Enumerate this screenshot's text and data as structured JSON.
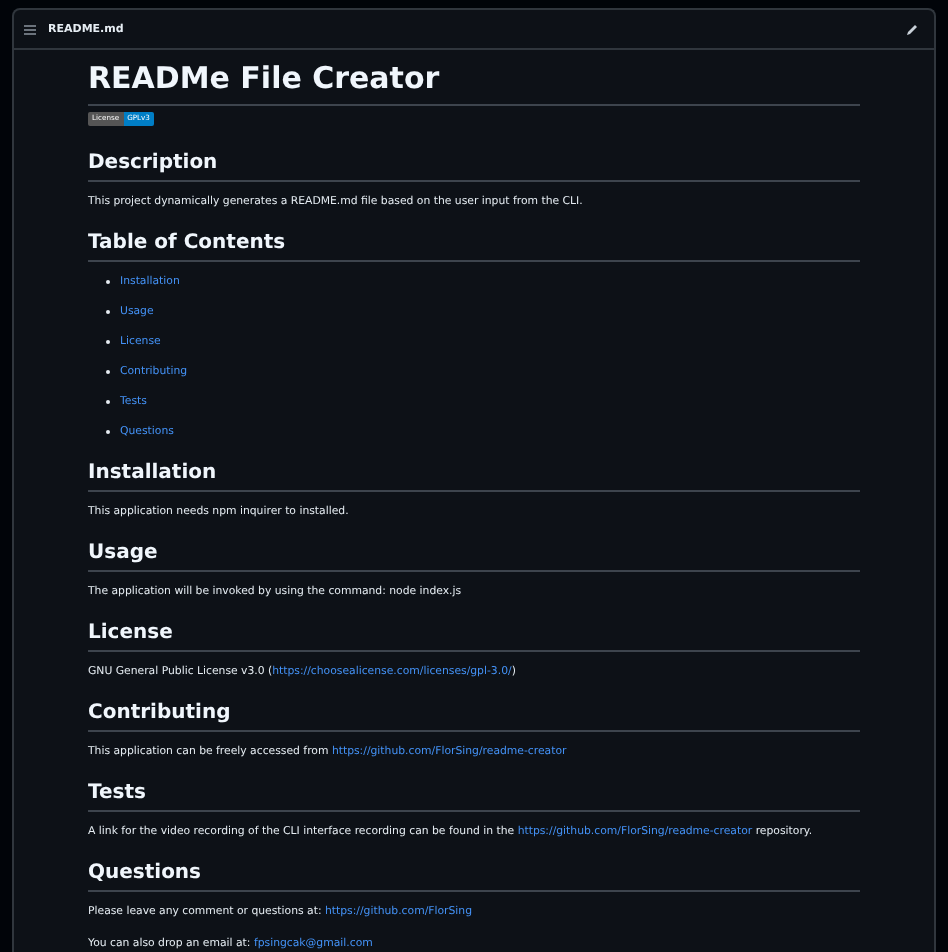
{
  "file_header": {
    "filename": "README.md"
  },
  "title": "READMe File Creator",
  "badge": {
    "label": "License",
    "value": "GPLv3"
  },
  "sections": [
    {
      "heading": "Description",
      "kind": "paragraphs",
      "paragraphs": [
        [
          {
            "kind": "text",
            "text": "This project dynamically generates a README.md file based on the user input from the CLI."
          }
        ]
      ]
    },
    {
      "heading": "Table of Contents",
      "kind": "list",
      "items": [
        "Installation",
        "Usage",
        "License",
        "Contributing",
        "Tests",
        "Questions"
      ]
    },
    {
      "heading": "Installation",
      "kind": "paragraphs",
      "paragraphs": [
        [
          {
            "kind": "text",
            "text": "This application needs npm inquirer to installed."
          }
        ]
      ]
    },
    {
      "heading": "Usage",
      "kind": "paragraphs",
      "paragraphs": [
        [
          {
            "kind": "text",
            "text": "The application will be invoked by using the command: node index.js"
          }
        ]
      ]
    },
    {
      "heading": "License",
      "kind": "paragraphs",
      "paragraphs": [
        [
          {
            "kind": "text",
            "text": "GNU General Public License v3.0 ("
          },
          {
            "kind": "link",
            "text": "https://choosealicense.com/licenses/gpl-3.0/"
          },
          {
            "kind": "text",
            "text": ")"
          }
        ]
      ]
    },
    {
      "heading": "Contributing",
      "kind": "paragraphs",
      "paragraphs": [
        [
          {
            "kind": "text",
            "text": "This application can be freely accessed from "
          },
          {
            "kind": "link",
            "text": "https://github.com/FlorSing/readme-creator"
          }
        ]
      ]
    },
    {
      "heading": "Tests",
      "kind": "paragraphs",
      "paragraphs": [
        [
          {
            "kind": "text",
            "text": "A link for the video recording of the CLI interface recording can be found in the "
          },
          {
            "kind": "link",
            "text": "https://github.com/FlorSing/readme-creator"
          },
          {
            "kind": "text",
            "text": " repository."
          }
        ]
      ]
    },
    {
      "heading": "Questions",
      "kind": "paragraphs",
      "paragraphs": [
        [
          {
            "kind": "text",
            "text": "Please leave any comment or questions at: "
          },
          {
            "kind": "link",
            "text": "https://github.com/FlorSing"
          }
        ],
        [
          {
            "kind": "text",
            "text": "You can also drop an email at: "
          },
          {
            "kind": "link",
            "text": "fpsingcak@gmail.com"
          }
        ]
      ]
    }
  ]
}
